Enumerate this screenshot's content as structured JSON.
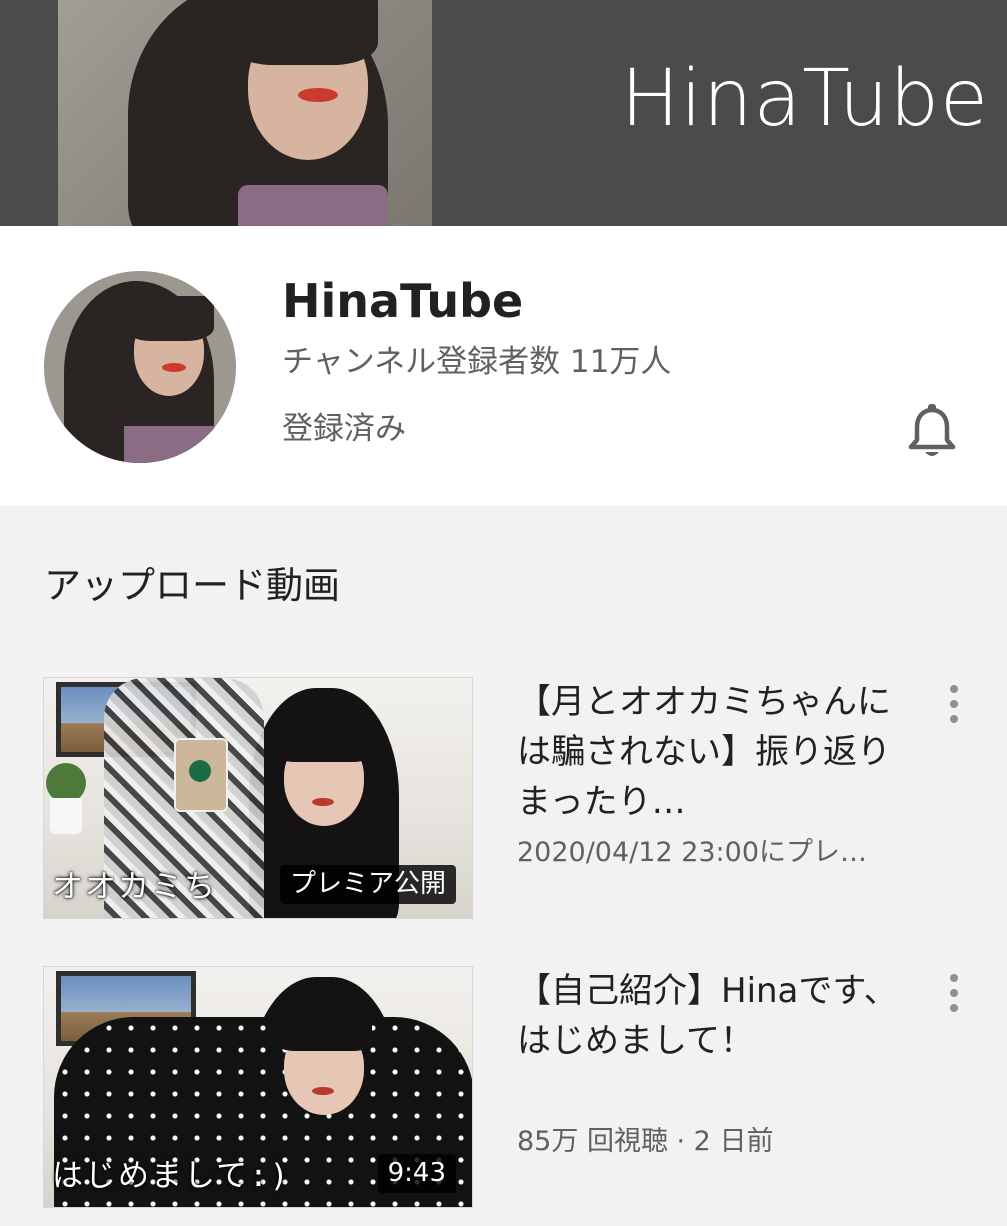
{
  "banner": {
    "title": "HinaTube"
  },
  "channel": {
    "name": "HinaTube",
    "subscribers": "チャンネル登録者数 11万人",
    "subscription_status": "登録済み",
    "notification_icon": "bell-icon"
  },
  "uploads": {
    "section_title": "アップロード動画",
    "videos": [
      {
        "title": "【月とオオカミちゃんには騙されない】振り返りまったり…",
        "meta": "2020/04/12 23:00にプレ…",
        "thumbnail_caption": "オオカミち",
        "badge": "プレミア公開",
        "menu_icon": "more-vert-icon"
      },
      {
        "title": "【自己紹介】Hinaです、はじめまして！",
        "meta": "85万 回視聴 · 2 日前",
        "thumbnail_caption": "はじめまして:)",
        "badge": "9:43",
        "menu_icon": "more-vert-icon"
      }
    ]
  },
  "colors": {
    "banner_bg": "#4b4b4b",
    "text_primary": "#212121",
    "text_secondary": "#606060",
    "page_bg": "#f2f2f2"
  }
}
